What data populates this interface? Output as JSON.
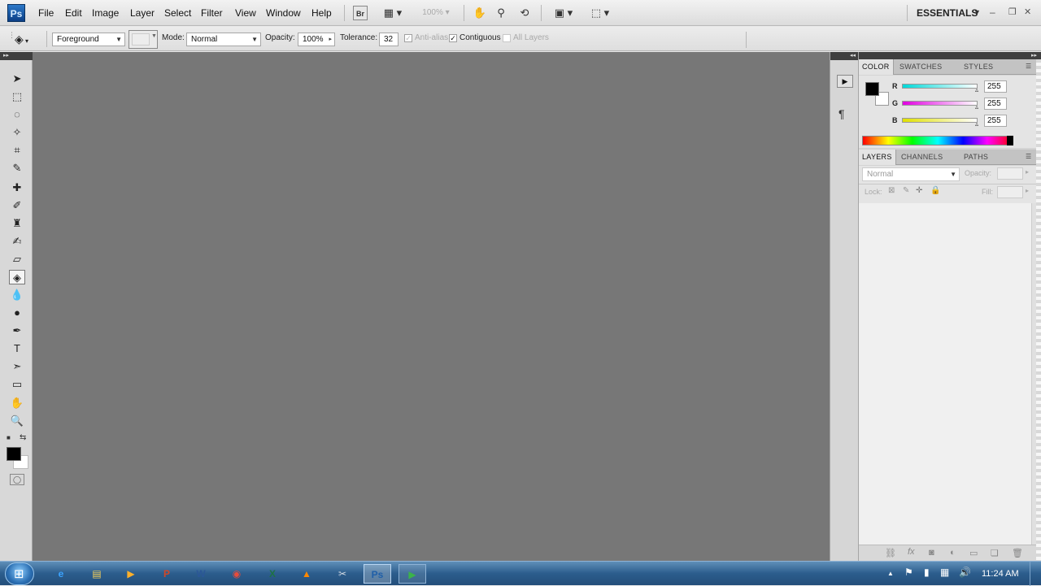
{
  "app": {
    "logo": "Ps",
    "workspace": "ESSENTIALS"
  },
  "menu": [
    "File",
    "Edit",
    "Image",
    "Layer",
    "Select",
    "Filter",
    "View",
    "Window",
    "Help"
  ],
  "appbar": {
    "bridge": "Br",
    "zoom": "100%"
  },
  "window_controls": {
    "minimize": "–",
    "restore": "❐",
    "close": "✕"
  },
  "options": {
    "fill_source": "Foreground",
    "mode_label": "Mode:",
    "mode_value": "Normal",
    "opacity_label": "Opacity:",
    "opacity_value": "100%",
    "tolerance_label": "Tolerance:",
    "tolerance_value": "32",
    "anti_alias": "Anti-alias",
    "contiguous": "Contiguous",
    "all_layers": "All Layers"
  },
  "tools": [
    {
      "name": "move-tool",
      "glyph": "➤"
    },
    {
      "name": "marquee-tool",
      "glyph": "⬚"
    },
    {
      "name": "lasso-tool",
      "glyph": "◌"
    },
    {
      "name": "magic-wand-tool",
      "glyph": "✧"
    },
    {
      "name": "crop-tool",
      "glyph": "⌗"
    },
    {
      "name": "eyedropper-tool",
      "glyph": "✎"
    },
    {
      "name": "healing-brush-tool",
      "glyph": "✚"
    },
    {
      "name": "brush-tool",
      "glyph": "✐"
    },
    {
      "name": "clone-stamp-tool",
      "glyph": "♜"
    },
    {
      "name": "history-brush-tool",
      "glyph": "✍"
    },
    {
      "name": "eraser-tool",
      "glyph": "▱"
    },
    {
      "name": "paint-bucket-tool",
      "glyph": "◈"
    },
    {
      "name": "blur-tool",
      "glyph": "💧"
    },
    {
      "name": "dodge-tool",
      "glyph": "●"
    },
    {
      "name": "pen-tool",
      "glyph": "✒"
    },
    {
      "name": "type-tool",
      "glyph": "T"
    },
    {
      "name": "path-selection-tool",
      "glyph": "➣"
    },
    {
      "name": "shape-tool",
      "glyph": "▭"
    },
    {
      "name": "hand-tool",
      "glyph": "✋"
    },
    {
      "name": "zoom-tool",
      "glyph": "🔍"
    }
  ],
  "color_panel": {
    "tabs": [
      "COLOR",
      "SWATCHES",
      "STYLES"
    ],
    "channels": [
      {
        "label": "R",
        "value": "255",
        "color": "#00d8d8"
      },
      {
        "label": "G",
        "value": "255",
        "color": "#e000e0"
      },
      {
        "label": "B",
        "value": "255",
        "color": "#e0e000"
      }
    ],
    "foreground": "#000000",
    "background": "#ffffff"
  },
  "layers_panel": {
    "tabs": [
      "LAYERS",
      "CHANNELS",
      "PATHS"
    ],
    "blend_mode": "Normal",
    "opacity_label": "Opacity:",
    "lock_label": "Lock:",
    "fill_label": "Fill:"
  },
  "taskbar": {
    "apps": [
      {
        "name": "ie-icon",
        "glyph": "e",
        "color": "#3aa3ff"
      },
      {
        "name": "explorer-icon",
        "glyph": "▤",
        "color": "#f5cf5a"
      },
      {
        "name": "media-player-icon",
        "glyph": "▶",
        "color": "#ffb02a"
      },
      {
        "name": "powerpoint-icon",
        "glyph": "P",
        "color": "#d24726"
      },
      {
        "name": "word-icon",
        "glyph": "W",
        "color": "#2b5797"
      },
      {
        "name": "chrome-icon",
        "glyph": "◉",
        "color": "#e74c3c"
      },
      {
        "name": "excel-icon",
        "glyph": "X",
        "color": "#1e7145"
      },
      {
        "name": "vlc-icon",
        "glyph": "▲",
        "color": "#ff8800"
      },
      {
        "name": "snipping-icon",
        "glyph": "✂",
        "color": "#cfd8e3"
      },
      {
        "name": "photoshop-icon",
        "glyph": "Ps",
        "color": "#1f5fa8"
      },
      {
        "name": "camtasia-icon",
        "glyph": "▶",
        "color": "#3bb34a"
      }
    ],
    "time": "11:24 AM"
  }
}
